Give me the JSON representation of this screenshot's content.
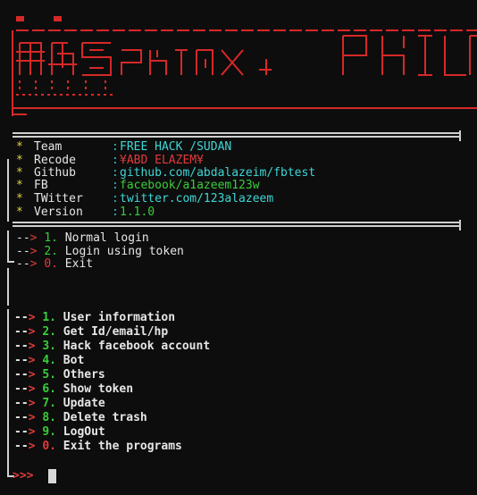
{
  "banner": {
    "title": "MrSphinx Philip",
    "color": "#d62828"
  },
  "info": [
    {
      "key": "Team",
      "sep": ":",
      "value": "FREE  HACK /SUDAN",
      "color": "#3fd6d6"
    },
    {
      "key": "Recode",
      "sep": ":",
      "value": "¥ABD ELAZEM¥",
      "color": "#e03a3a"
    },
    {
      "key": "Github",
      "sep": ":",
      "value": "github.com/abdalazeim/fbtest",
      "color": "#3fd6d6"
    },
    {
      "key": "FB",
      "sep": ":",
      "value": "facebook/a1azeem123w",
      "color": "#3acd3a"
    },
    {
      "key": "TWitter",
      "sep": ":",
      "value": "twitter.com/123alazeem",
      "color": "#3fd6d6"
    },
    {
      "key": "Version",
      "sep": ":",
      "value": "1.1.0",
      "color": "#3acd3a"
    }
  ],
  "login_menu": [
    {
      "arrow": "-->",
      "num": "1.",
      "label": "Normal login"
    },
    {
      "arrow": "-->",
      "num": "2.",
      "label": "Login using token"
    },
    {
      "arrow": "-->",
      "num": "0.",
      "label": "Exit"
    }
  ],
  "main_menu": [
    {
      "arrow": "-->",
      "num": "1.",
      "label": "User information"
    },
    {
      "arrow": "-->",
      "num": "2.",
      "label": "Get Id/email/hp"
    },
    {
      "arrow": "-->",
      "num": "3.",
      "label": "Hack facebook account"
    },
    {
      "arrow": "-->",
      "num": "4.",
      "label": "Bot"
    },
    {
      "arrow": "-->",
      "num": "5.",
      "label": "Others"
    },
    {
      "arrow": "-->",
      "num": "6.",
      "label": "Show token"
    },
    {
      "arrow": "-->",
      "num": "7.",
      "label": "Update"
    },
    {
      "arrow": "-->",
      "num": "8.",
      "label": "Delete trash"
    },
    {
      "arrow": "-->",
      "num": "9.",
      "label": "LogOut"
    },
    {
      "arrow": "-->",
      "num": "0.",
      "label": "Exit the programs"
    }
  ],
  "prompt": ">>>"
}
